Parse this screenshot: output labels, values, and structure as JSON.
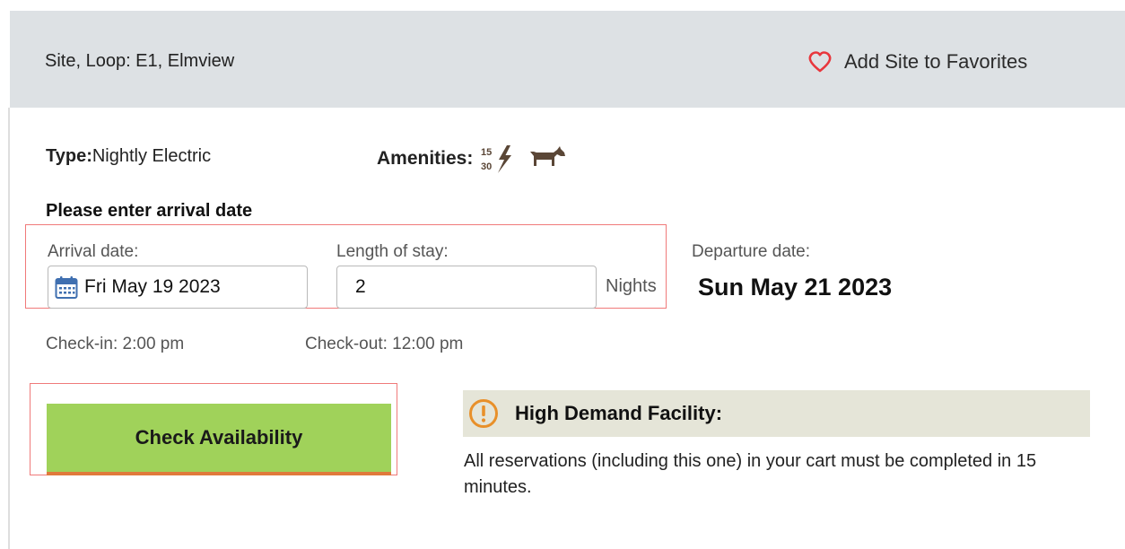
{
  "header": {
    "site_loop": "Site, Loop: E1, Elmview",
    "favorites_label": "Add Site to Favorites"
  },
  "site_info": {
    "type_label": "Type:",
    "type_value": "Nightly Electric",
    "amenities_label": "Amenities:",
    "amenity_icons": [
      "electric-15-30-amp-icon",
      "pet-friendly-dog-icon"
    ]
  },
  "booking": {
    "prompt": "Please enter arrival date",
    "arrival_label": "Arrival date:",
    "arrival_value": "Fri May 19 2023",
    "length_label": "Length of stay:",
    "length_value": "2",
    "nights_unit": "Nights",
    "departure_label": "Departure date:",
    "departure_value": "Sun May 21 2023",
    "checkin": "Check-in: 2:00 pm",
    "checkout": "Check-out: 12:00 pm"
  },
  "actions": {
    "check_availability": "Check Availability"
  },
  "notice": {
    "title": "High Demand Facility:",
    "description": "All reservations (including this one) in your cart must be completed in 15 minutes."
  },
  "colors": {
    "header_bg": "#dde1e4",
    "button_bg": "#a0d25a",
    "highlight_box": "#f07a7a",
    "notice_bg": "#e5e5d8",
    "warning_icon": "#e8902a",
    "heart": "#e8363c",
    "amenity_icon": "#5a4636"
  }
}
